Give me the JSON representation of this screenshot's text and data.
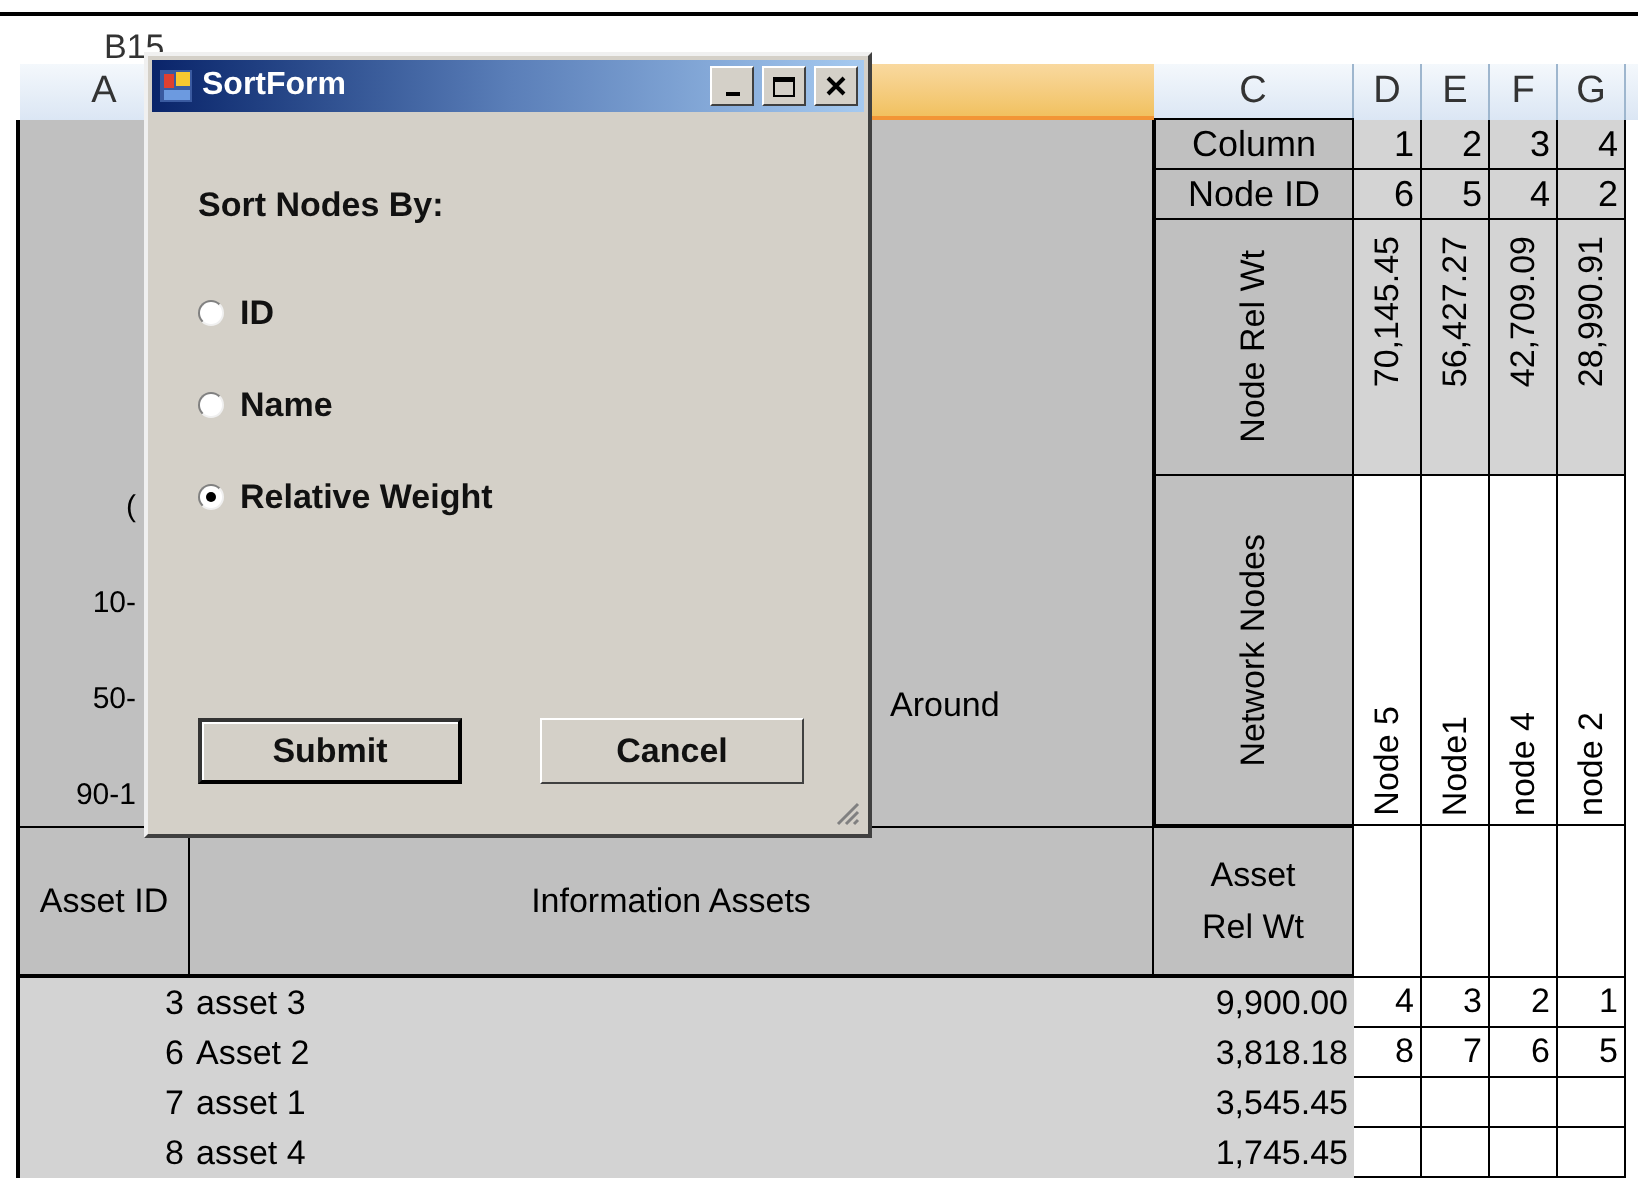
{
  "spreadsheet": {
    "name_box": "B15",
    "column_headers": [
      {
        "label": "A"
      },
      {
        "label": "C"
      },
      {
        "label": "D"
      },
      {
        "label": "E"
      },
      {
        "label": "F"
      },
      {
        "label": "G"
      }
    ],
    "row_labels": [
      "(",
      "10-",
      "50-",
      "90-1"
    ],
    "column_b_text": "Around",
    "node_rows": [
      {
        "kind": "plain",
        "label": "Column",
        "values": [
          "1",
          "2",
          "3",
          "4"
        ]
      },
      {
        "kind": "plain",
        "label": "Node ID",
        "values": [
          "6",
          "5",
          "4",
          "2"
        ]
      },
      {
        "kind": "weight",
        "label": "Node Rel Wt",
        "values": [
          "70,145.45",
          "56,427.27",
          "42,709.09",
          "28,990.91"
        ]
      },
      {
        "kind": "name",
        "label": "Network Nodes",
        "values": [
          "Node 5",
          "Node1",
          "node 4",
          "node 2"
        ]
      }
    ],
    "asset_header": {
      "id": "Asset ID",
      "name": "Information Assets",
      "weight": "Asset Rel Wt"
    },
    "assets": [
      {
        "id": "3",
        "name": "asset 3",
        "weight": "9,900.00",
        "ranks": [
          "4",
          "3",
          "2",
          "1"
        ]
      },
      {
        "id": "6",
        "name": "Asset 2",
        "weight": "3,818.18",
        "ranks": [
          "8",
          "7",
          "6",
          "5"
        ]
      },
      {
        "id": "7",
        "name": "asset 1",
        "weight": "3,545.45"
      },
      {
        "id": "8",
        "name": "asset 4",
        "weight": "1,745.45"
      }
    ]
  },
  "dialog": {
    "title": "SortForm",
    "prompt": "Sort Nodes By:",
    "options": [
      {
        "label": "ID",
        "selected": false
      },
      {
        "label": "Name",
        "selected": false
      },
      {
        "label": "Relative Weight",
        "selected": true
      }
    ],
    "buttons": [
      {
        "label": "Submit",
        "default": true
      },
      {
        "label": "Cancel",
        "default": false
      }
    ]
  }
}
